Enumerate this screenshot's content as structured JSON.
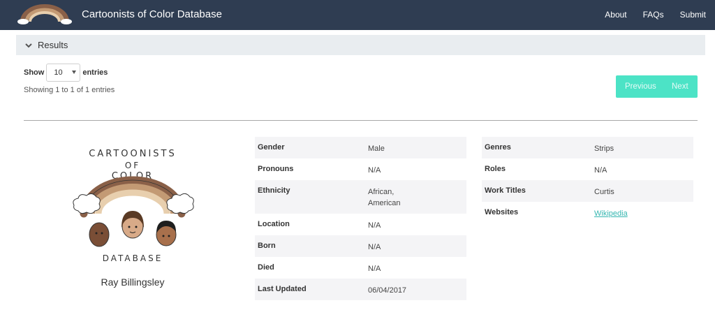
{
  "navbar": {
    "brand": "Cartoonists of Color Database",
    "links": [
      "About",
      "FAQs",
      "Submit"
    ]
  },
  "results": {
    "label": "Results"
  },
  "controls": {
    "show_label": "Show",
    "page_length": "10",
    "entries_label": "entries",
    "info": "Showing 1 to 1 of 1 entries",
    "prev_label": "Previous",
    "next_label": "Next"
  },
  "logo_text": {
    "top": "CARTOONISTS",
    "of": "OF",
    "color": "COLOR",
    "bottom": "DATABASE"
  },
  "artist": {
    "name": "Ray Billingsley",
    "left_fields": [
      {
        "label": "Gender",
        "value": "Male"
      },
      {
        "label": "Pronouns",
        "value": "N/A"
      },
      {
        "label": "Ethnicity",
        "value": "African,\nAmerican"
      },
      {
        "label": "Location",
        "value": "N/A"
      },
      {
        "label": "Born",
        "value": "N/A"
      },
      {
        "label": "Died",
        "value": "N/A"
      },
      {
        "label": "Last Updated",
        "value": "06/04/2017"
      }
    ],
    "right_fields": [
      {
        "label": "Genres",
        "value": "Strips"
      },
      {
        "label": "Roles",
        "value": "N/A"
      },
      {
        "label": "Work Titles",
        "value": "Curtis"
      },
      {
        "label": "Websites",
        "value": "Wikipedia"
      }
    ]
  },
  "colors": {
    "navbar": "#2f3d52",
    "results_bar": "#e9edf0",
    "pager": "#4ce3c6",
    "link": "#35b6b0",
    "row_shade": "#f4f4f6"
  }
}
